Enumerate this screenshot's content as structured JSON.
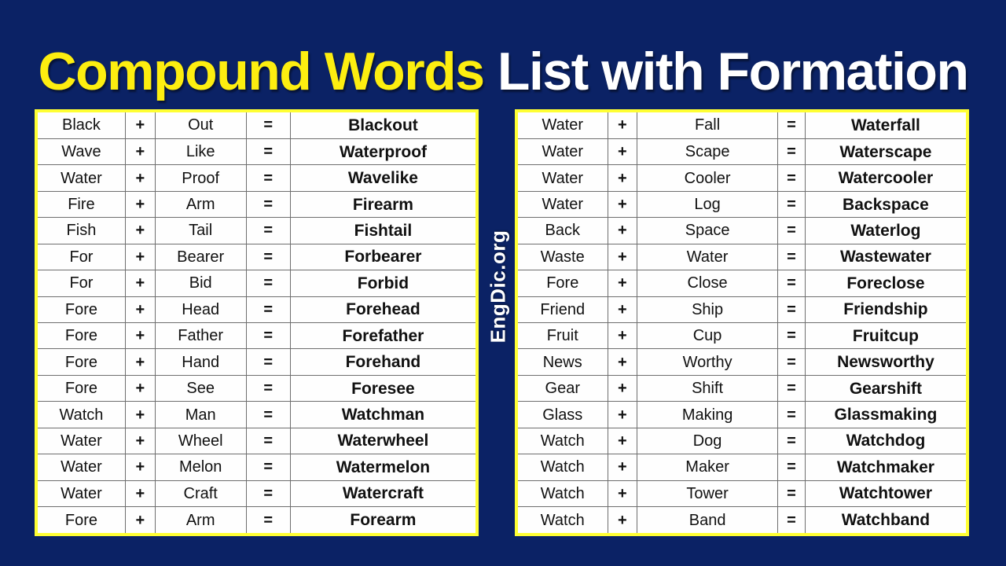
{
  "background_color": "#0b2265",
  "accent_yellow": "#fdee10",
  "border_yellow": "#ffff33",
  "title": {
    "highlight": "Compound Words",
    "rest": " List with Formation"
  },
  "watermark": {
    "label": "EngDic.org"
  },
  "symbols": {
    "plus": "+",
    "equals": "="
  },
  "tables": [
    {
      "id": "left-table",
      "rows": [
        {
          "word1": "Black",
          "word2": "Out",
          "result": "Blackout"
        },
        {
          "word1": "Wave",
          "word2": "Like",
          "result": "Waterproof"
        },
        {
          "word1": "Water",
          "word2": "Proof",
          "result": "Wavelike"
        },
        {
          "word1": "Fire",
          "word2": "Arm",
          "result": "Firearm"
        },
        {
          "word1": "Fish",
          "word2": "Tail",
          "result": "Fishtail"
        },
        {
          "word1": "For",
          "word2": "Bearer",
          "result": "Forbearer"
        },
        {
          "word1": "For",
          "word2": "Bid",
          "result": "Forbid"
        },
        {
          "word1": "Fore",
          "word2": "Head",
          "result": "Forehead"
        },
        {
          "word1": "Fore",
          "word2": "Father",
          "result": "Forefather"
        },
        {
          "word1": "Fore",
          "word2": "Hand",
          "result": "Forehand"
        },
        {
          "word1": "Fore",
          "word2": "See",
          "result": "Foresee"
        },
        {
          "word1": "Watch",
          "word2": "Man",
          "result": "Watchman"
        },
        {
          "word1": "Water",
          "word2": "Wheel",
          "result": "Waterwheel"
        },
        {
          "word1": "Water",
          "word2": "Melon",
          "result": "Watermelon"
        },
        {
          "word1": "Water",
          "word2": "Craft",
          "result": "Watercraft"
        },
        {
          "word1": "Fore",
          "word2": "Arm",
          "result": "Forearm"
        }
      ]
    },
    {
      "id": "right-table",
      "rows": [
        {
          "word1": "Water",
          "word2": "Fall",
          "result": "Waterfall"
        },
        {
          "word1": "Water",
          "word2": "Scape",
          "result": "Waterscape"
        },
        {
          "word1": "Water",
          "word2": "Cooler",
          "result": "Watercooler"
        },
        {
          "word1": "Water",
          "word2": "Log",
          "result": "Backspace"
        },
        {
          "word1": "Back",
          "word2": "Space",
          "result": "Waterlog"
        },
        {
          "word1": "Waste",
          "word2": "Water",
          "result": "Wastewater"
        },
        {
          "word1": "Fore",
          "word2": "Close",
          "result": "Foreclose"
        },
        {
          "word1": "Friend",
          "word2": "Ship",
          "result": "Friendship"
        },
        {
          "word1": "Fruit",
          "word2": "Cup",
          "result": "Fruitcup"
        },
        {
          "word1": "News",
          "word2": "Worthy",
          "result": "Newsworthy"
        },
        {
          "word1": "Gear",
          "word2": "Shift",
          "result": "Gearshift"
        },
        {
          "word1": "Glass",
          "word2": "Making",
          "result": "Glassmaking"
        },
        {
          "word1": "Watch",
          "word2": "Dog",
          "result": "Watchdog"
        },
        {
          "word1": "Watch",
          "word2": "Maker",
          "result": "Watchmaker"
        },
        {
          "word1": "Watch",
          "word2": "Tower",
          "result": "Watchtower"
        },
        {
          "word1": "Watch",
          "word2": "Band",
          "result": "Watchband"
        }
      ]
    }
  ]
}
